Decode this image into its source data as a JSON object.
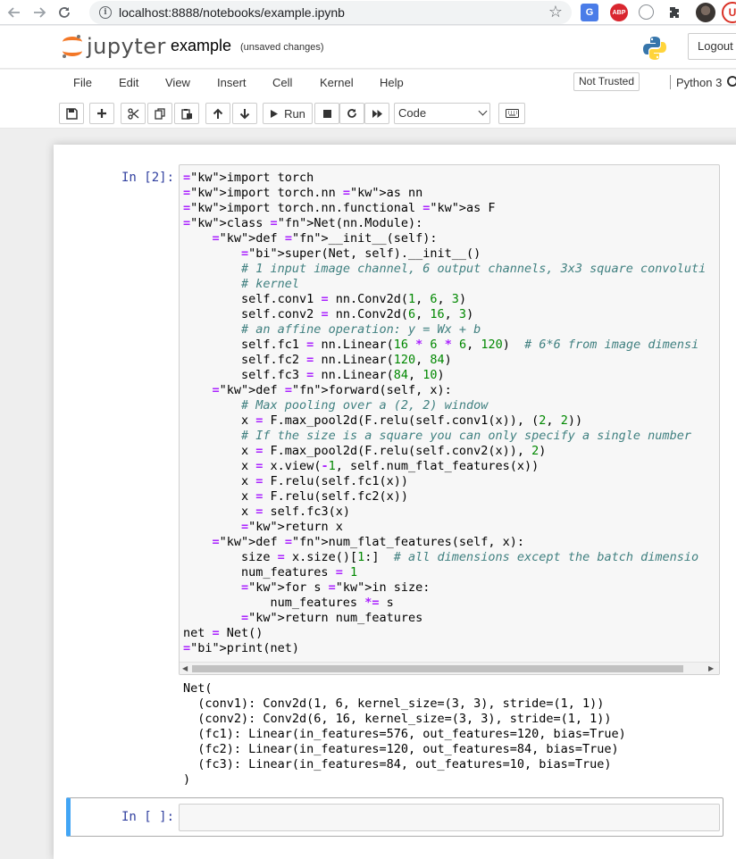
{
  "browser": {
    "url": "localhost:8888/notebooks/example.ipynb",
    "back_icon": "arrow-left-icon",
    "forward_icon": "arrow-right-icon",
    "reload_icon": "reload-icon",
    "translate_label": "G",
    "abp_label": "ABP",
    "profile_label": "U"
  },
  "header": {
    "logo_text": "jupyter",
    "notebook_name": "example",
    "save_status": "(unsaved changes)",
    "logout_label": "Logout"
  },
  "menubar": {
    "items": [
      "File",
      "Edit",
      "View",
      "Insert",
      "Cell",
      "Kernel",
      "Help"
    ],
    "trust_label": "Not Trusted",
    "kernel_name": "Python 3"
  },
  "toolbar": {
    "run_label": "Run",
    "cell_type": "Code"
  },
  "cells": [
    {
      "prompt": "In [2]:",
      "code": [
        "import torch",
        "import torch.nn as nn",
        "import torch.nn.functional as F",
        "class Net(nn.Module):",
        "    def __init__(self):",
        "        super(Net, self).__init__()",
        "        # 1 input image channel, 6 output channels, 3x3 square convoluti",
        "        # kernel",
        "        self.conv1 = nn.Conv2d(1, 6, 3)",
        "        self.conv2 = nn.Conv2d(6, 16, 3)",
        "        # an affine operation: y = Wx + b",
        "        self.fc1 = nn.Linear(16 * 6 * 6, 120)  # 6*6 from image dimensi",
        "        self.fc2 = nn.Linear(120, 84)",
        "        self.fc3 = nn.Linear(84, 10)",
        "    def forward(self, x):",
        "        # Max pooling over a (2, 2) window",
        "        x = F.max_pool2d(F.relu(self.conv1(x)), (2, 2))",
        "        # If the size is a square you can only specify a single number",
        "        x = F.max_pool2d(F.relu(self.conv2(x)), 2)",
        "        x = x.view(-1, self.num_flat_features(x))",
        "        x = F.relu(self.fc1(x))",
        "        x = F.relu(self.fc2(x))",
        "        x = self.fc3(x)",
        "        return x",
        "    def num_flat_features(self, x):",
        "        size = x.size()[1:]  # all dimensions except the batch dimensio",
        "        num_features = 1",
        "        for s in size:",
        "            num_features *= s",
        "        return num_features",
        "net = Net()",
        "print(net)"
      ],
      "output": [
        "Net(",
        "  (conv1): Conv2d(1, 6, kernel_size=(3, 3), stride=(1, 1))",
        "  (conv2): Conv2d(6, 16, kernel_size=(3, 3), stride=(1, 1))",
        "  (fc1): Linear(in_features=576, out_features=120, bias=True)",
        "  (fc2): Linear(in_features=120, out_features=84, bias=True)",
        "  (fc3): Linear(in_features=84, out_features=10, bias=True)",
        ")"
      ]
    },
    {
      "prompt": "In [ ]:",
      "code": []
    }
  ],
  "colors": {
    "jupyter_orange": "#f37726",
    "prompt_blue": "#303f9f",
    "selected_border": "#42a5f5"
  }
}
